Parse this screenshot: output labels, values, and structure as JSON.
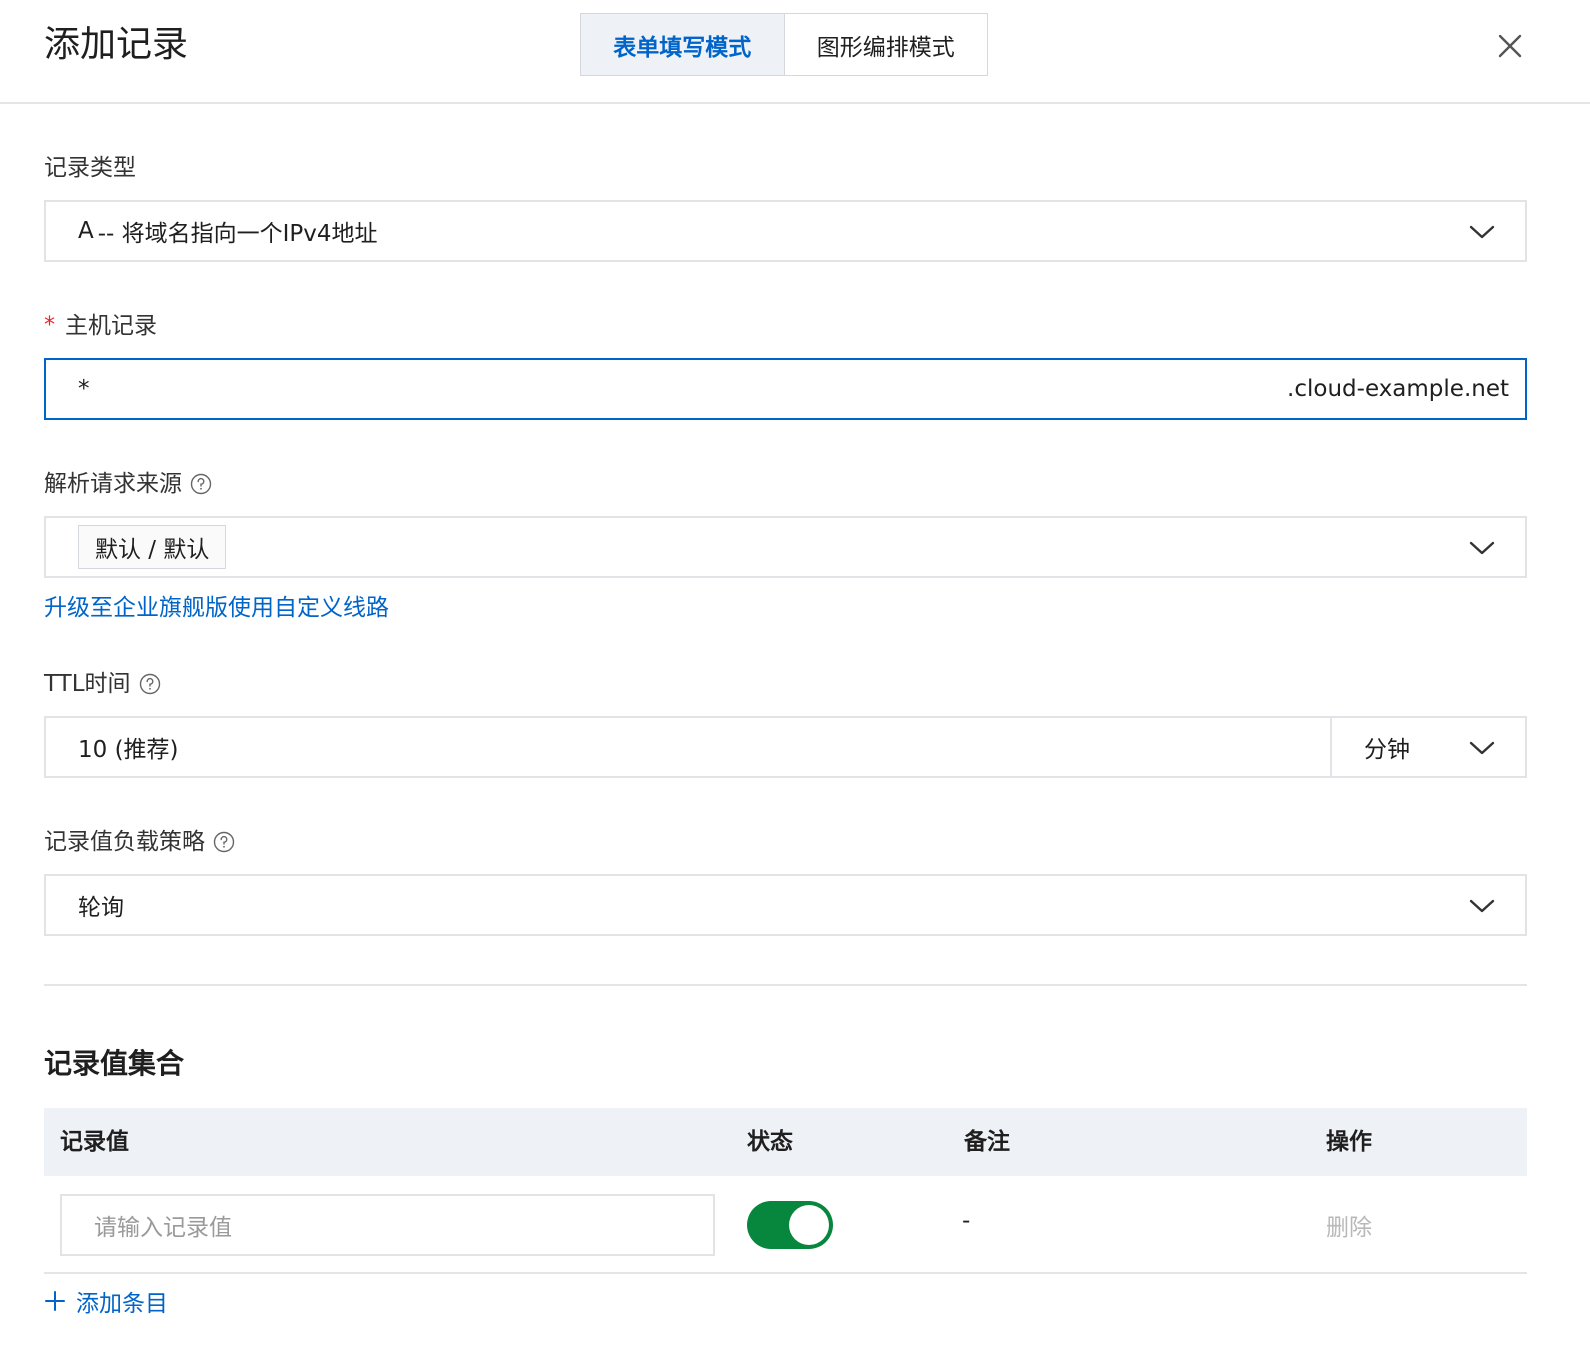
{
  "header": {
    "title": "添加记录",
    "tabs": [
      {
        "label": "表单填写模式",
        "active": true
      },
      {
        "label": "图形编排模式",
        "active": false
      }
    ]
  },
  "form": {
    "record_type": {
      "label": "记录类型",
      "value_prefix": "A",
      "value_desc": " -- 将域名指向一个IPv4地址"
    },
    "host": {
      "required_mark": "*",
      "label": "主机记录",
      "value": "*",
      "suffix": ".cloud-example.net"
    },
    "source": {
      "label": "解析请求来源",
      "tag": "默认 / 默认",
      "upgrade_link": "升级至企业旗舰版使用自定义线路"
    },
    "ttl": {
      "label": "TTL时间",
      "value": "10 (推荐)",
      "unit": "分钟"
    },
    "strategy": {
      "label": "记录值负载策略",
      "value": "轮询"
    }
  },
  "records": {
    "title": "记录值集合",
    "columns": [
      "记录值",
      "状态",
      "备注",
      "操作"
    ],
    "rows": [
      {
        "value_placeholder": "请输入记录值",
        "enabled": true,
        "note": "-",
        "action": "删除"
      }
    ],
    "add_label": "添加条目"
  },
  "colors": {
    "primary": "#0064c8",
    "toggle_on": "#07863e",
    "required": "#e3292f"
  }
}
